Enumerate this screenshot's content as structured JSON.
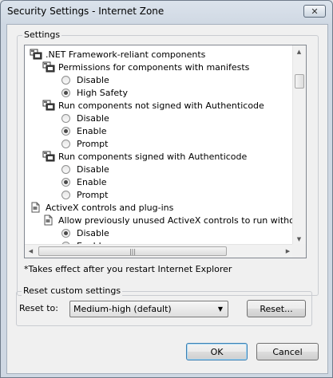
{
  "window": {
    "title": "Security Settings - Internet Zone",
    "close_glyph": "✕"
  },
  "settings_group": {
    "label": "Settings"
  },
  "list_items": [
    {
      "kind": "category",
      "icon": "settings-category-icon",
      "label": ".NET Framework-reliant components",
      "indent": 0
    },
    {
      "kind": "setting",
      "icon": "settings-category-icon",
      "label": "Permissions for components with manifests",
      "indent": 1
    },
    {
      "kind": "option",
      "checked": false,
      "label": "Disable",
      "indent": 2
    },
    {
      "kind": "option",
      "checked": true,
      "label": "High Safety",
      "indent": 2
    },
    {
      "kind": "setting",
      "icon": "settings-category-icon",
      "label": "Run components not signed with Authenticode",
      "indent": 1
    },
    {
      "kind": "option",
      "checked": false,
      "label": "Disable",
      "indent": 2
    },
    {
      "kind": "option",
      "checked": true,
      "label": "Enable",
      "indent": 2
    },
    {
      "kind": "option",
      "checked": false,
      "label": "Prompt",
      "indent": 2
    },
    {
      "kind": "setting",
      "icon": "settings-category-icon",
      "label": "Run components signed with Authenticode",
      "indent": 1
    },
    {
      "kind": "option",
      "checked": false,
      "label": "Disable",
      "indent": 2
    },
    {
      "kind": "option",
      "checked": true,
      "label": "Enable",
      "indent": 2
    },
    {
      "kind": "option",
      "checked": false,
      "label": "Prompt",
      "indent": 2
    },
    {
      "kind": "category",
      "icon": "document-icon",
      "label": "ActiveX controls and plug-ins",
      "indent": 0
    },
    {
      "kind": "setting",
      "icon": "document-icon",
      "label": "Allow previously unused ActiveX controls to run without prom",
      "indent": 1
    },
    {
      "kind": "option",
      "checked": true,
      "label": "Disable",
      "indent": 2
    },
    {
      "kind": "option",
      "checked": false,
      "label": "Enable",
      "indent": 2
    }
  ],
  "scrollbar": {
    "up": "▲",
    "down": "▼",
    "left": "◀",
    "right": "▶",
    "grip": "|||"
  },
  "note": "*Takes effect after you restart Internet Explorer",
  "reset_group": {
    "label": "Reset custom settings",
    "reset_to_label": "Reset to:",
    "selected": "Medium-high (default)",
    "dropdown_arrow": "▼",
    "reset_button": "Reset..."
  },
  "ok_button": "OK",
  "cancel_button": "Cancel"
}
